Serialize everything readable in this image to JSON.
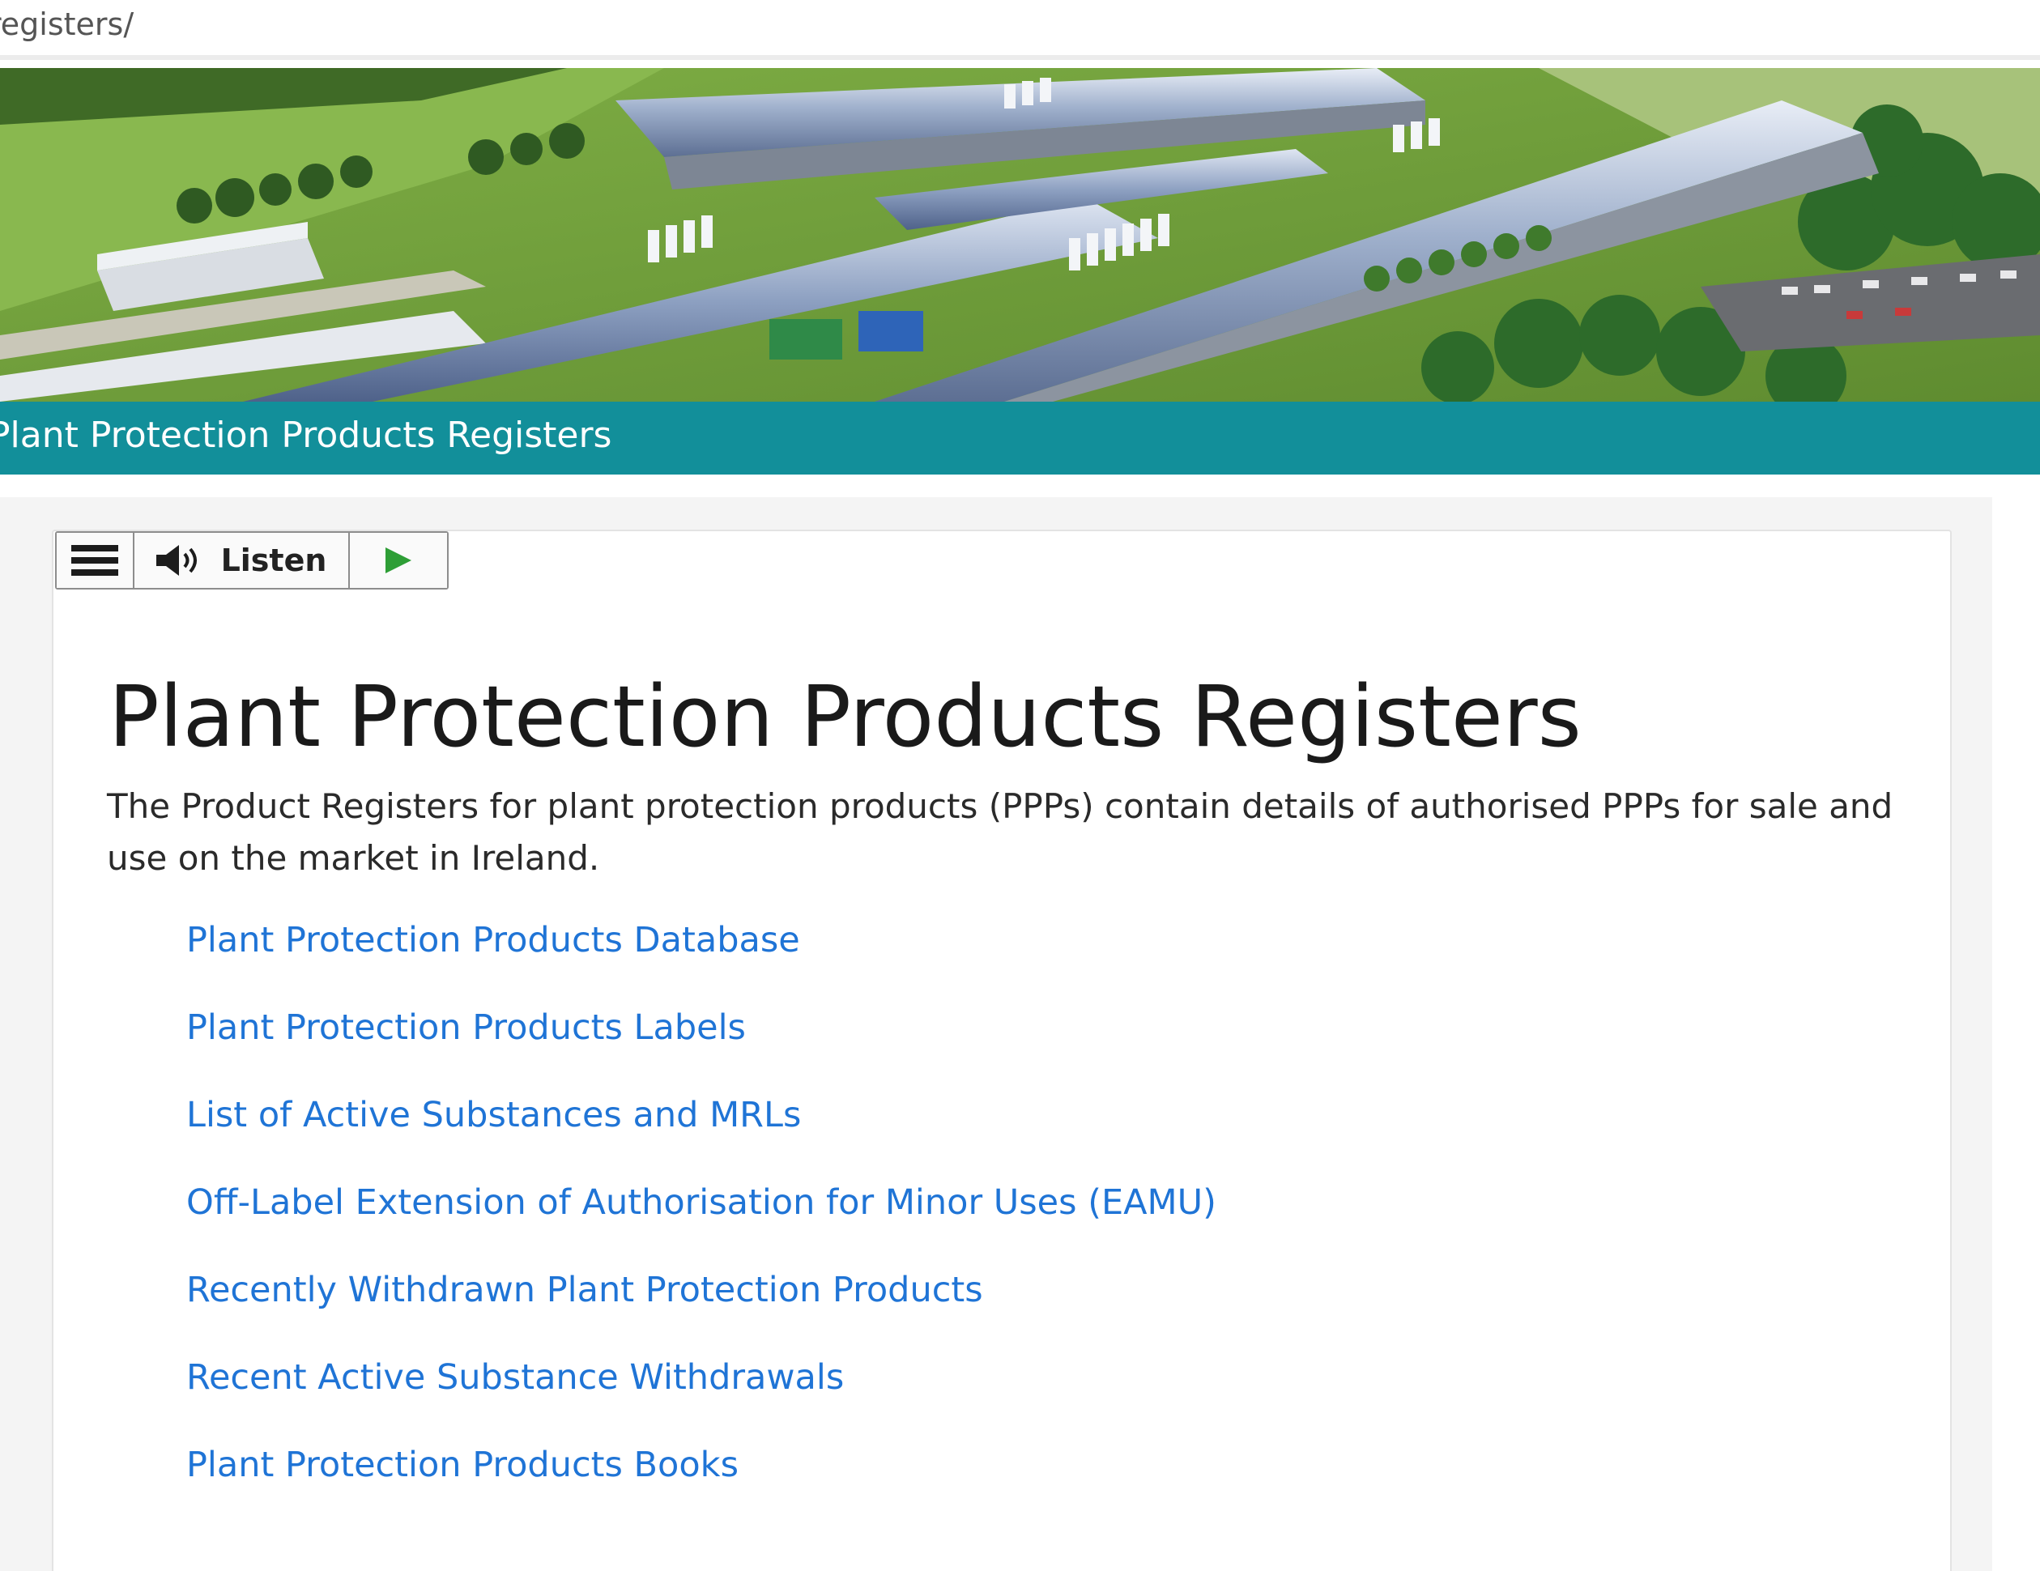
{
  "browser": {
    "url_fragment": "registers/"
  },
  "banner": {
    "title": "Plant Protection Products Registers"
  },
  "toolbar": {
    "menu_icon": "hamburger-menu-icon",
    "speaker_icon": "speaker-icon",
    "listen_label": "Listen",
    "play_icon": "play-icon",
    "play_color": "#2e9e36"
  },
  "main": {
    "title": "Plant Protection Products Registers",
    "intro": "The Product Registers for plant protection products (PPPs) contain details of authorised PPPs for sale and use on the market in Ireland.",
    "links": [
      {
        "label": "Plant Protection Products Database"
      },
      {
        "label": "Plant Protection Products Labels"
      },
      {
        "label": "List of Active Substances and MRLs"
      },
      {
        "label": "Off-Label Extension of Authorisation for Minor Uses (EAMU)"
      },
      {
        "label": "Recently Withdrawn Plant Protection Products"
      },
      {
        "label": "Recent Active Substance Withdrawals"
      },
      {
        "label": "Plant Protection Products Books"
      }
    ]
  },
  "colors": {
    "banner": "#128f9a",
    "link": "#1f74d6",
    "background": "#f4f4f4"
  }
}
